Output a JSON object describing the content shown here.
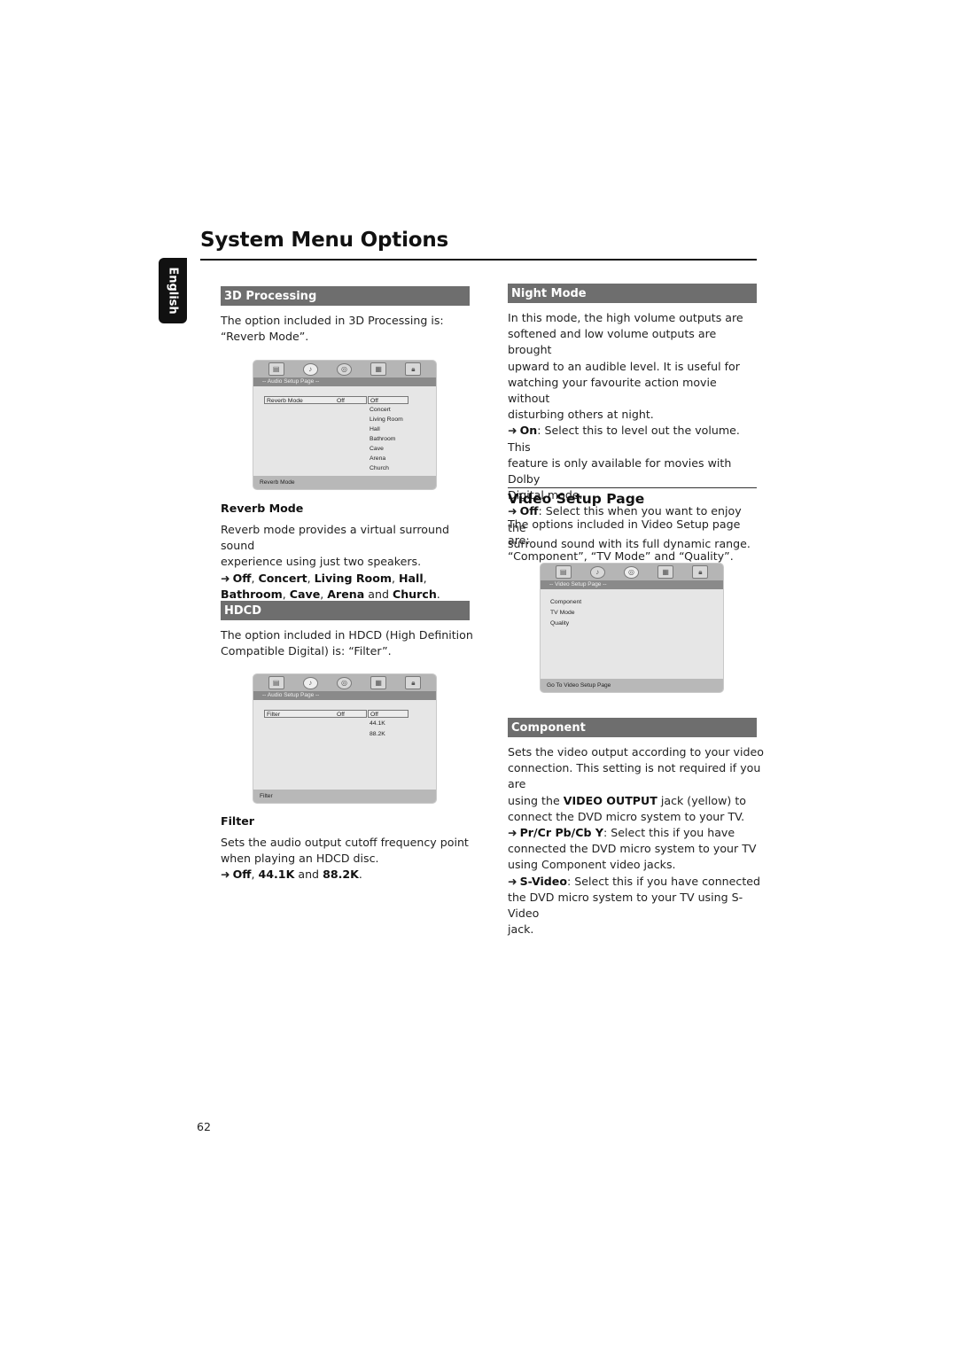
{
  "page": {
    "title": "System Menu Options",
    "language_tab": "English",
    "page_number": "62"
  },
  "left": {
    "processing": {
      "heading": "3D Processing",
      "intro_line1": "The option included in 3D Processing is:",
      "intro_line2": "“Reverb Mode”.",
      "osd": {
        "page_label": "-- Audio Setup Page --",
        "icons": [
          "general-setup-icon",
          "audio-setup-icon",
          "video-setup-icon",
          "preference-icon",
          "password-lock-icon"
        ],
        "field_label": "Reverb Mode",
        "field_value": "Off",
        "options": [
          "Off",
          "Concert",
          "Living Room",
          "Hall",
          "Bathroom",
          "Cave",
          "Arena",
          "Church"
        ],
        "footer": "Reverb Mode"
      },
      "sub_heading": "Reverb Mode",
      "desc_line1": "Reverb mode provides a virtual surround sound",
      "desc_line2": "experience using just two speakers.",
      "opt_arrow": "➜",
      "opts": {
        "off": "Off",
        "concert": "Concert",
        "living": "Living Room",
        "hall": "Hall",
        "bath": "Bathroom",
        "cave": "Cave",
        "arena": "Arena",
        "and": "and",
        "church": "Church"
      }
    },
    "hdcd": {
      "heading": "HDCD",
      "intro_line1": "The option included in HDCD (High Definition",
      "intro_line2": "Compatible Digital) is: “Filter”.",
      "osd": {
        "page_label": "-- Audio Setup Page --",
        "field_label": "Filter",
        "field_value": "Off",
        "options": [
          "Off",
          "44.1K",
          "88.2K"
        ],
        "footer": "Filter"
      },
      "sub_heading": "Filter",
      "desc_line1": "Sets the audio output cutoff frequency point",
      "desc_line2": "when playing an HDCD disc.",
      "opt_arrow": "➜",
      "opts": {
        "off": "Off",
        "k441": "44.1K",
        "and": "and",
        "k882": "88.2K"
      }
    }
  },
  "right": {
    "night": {
      "heading": "Night Mode",
      "lines": [
        "In this mode, the high volume outputs are",
        "softened and low volume outputs are brought",
        "upward to an audible level. It is useful for",
        "watching your favourite action movie without",
        "disturbing others at night."
      ],
      "on_label": "On",
      "on_line1": ": Select this to level out the volume. This",
      "on_line2": "feature is only available for movies with Dolby",
      "on_line3": "Digital mode.",
      "off_label": "Off",
      "off_line1": ": Select this when you want to enjoy the",
      "off_line2": "surround sound with its full dynamic range.",
      "arrow": "➜"
    },
    "video": {
      "heading": "Video Setup Page",
      "intro_line1": "The options included in Video Setup page are:",
      "intro_line2": "“Component”, “TV Mode” and “Quality”.",
      "osd": {
        "page_label": "-- Video Setup Page --",
        "items": [
          "Component",
          "TV Mode",
          "Quality"
        ],
        "footer": "Go To Video Setup Page"
      }
    },
    "component": {
      "heading": "Component",
      "line1": "Sets the video output according to your video",
      "line2": "connection. This setting is not required if you are",
      "line3_pre": "using the ",
      "line3_bold": "VIDEO OUTPUT",
      "line3_post": " jack (yellow) to",
      "line4": "connect the DVD micro system to your TV.",
      "arrow": "➜",
      "pr_label": "Pr/Cr Pb/Cb Y",
      "pr_line1": ": Select this if you have",
      "pr_line2": "connected the DVD micro system to your TV",
      "pr_line3": "using Component video jacks.",
      "sv_label": "S-Video",
      "sv_line1": ": Select this if you have connected",
      "sv_line2": "the DVD micro system to your TV using S-Video",
      "sv_line3": "jack."
    }
  }
}
